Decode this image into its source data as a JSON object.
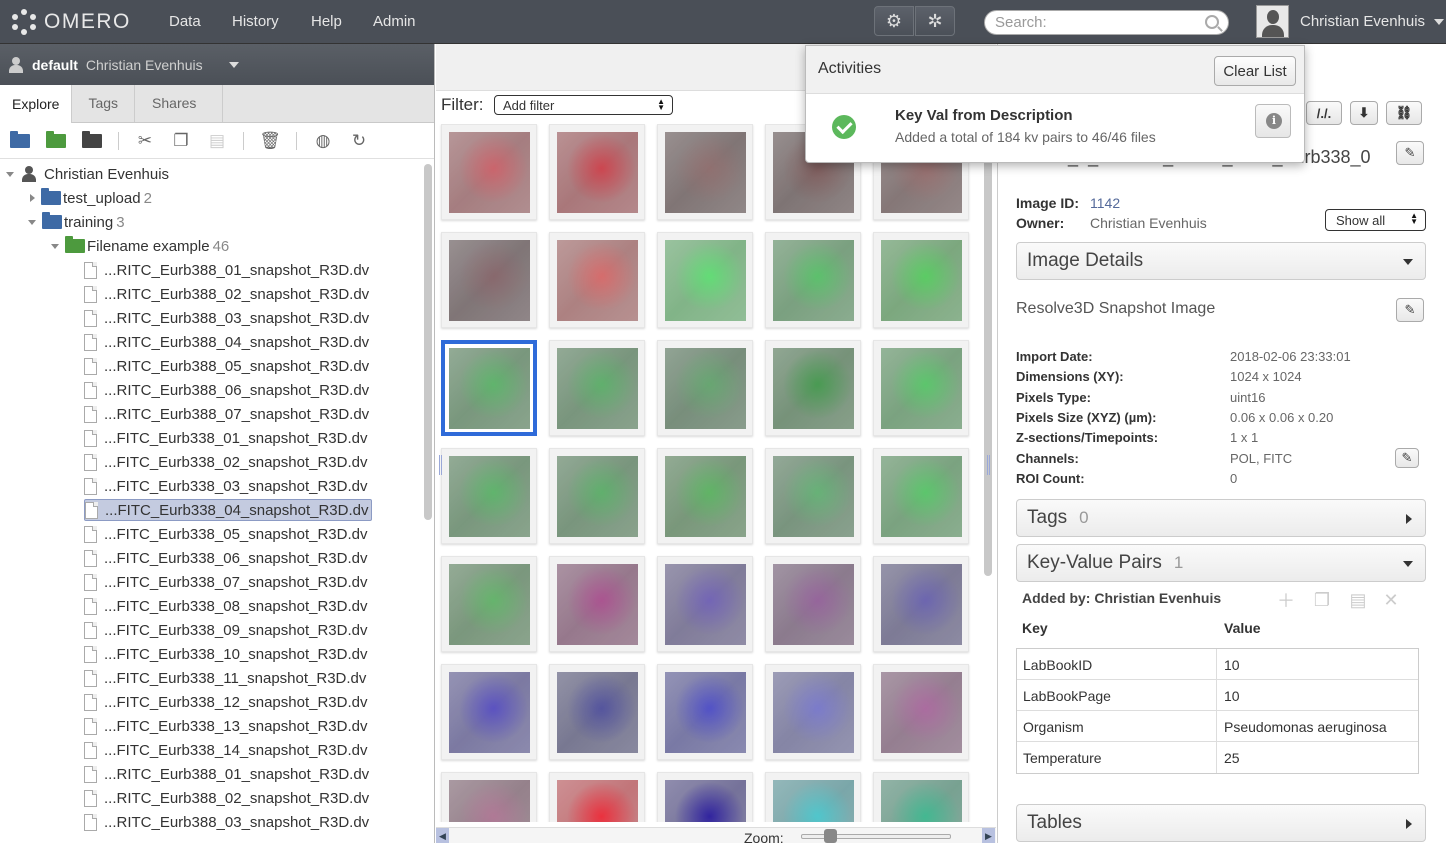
{
  "topbar": {
    "logo_text": "OMERO",
    "nav": [
      "Data",
      "History",
      "Help",
      "Admin"
    ],
    "search_placeholder": "Search:",
    "user_name": "Christian Evenhuis"
  },
  "left": {
    "group": "default",
    "owner": "Christian Evenhuis",
    "tabs": [
      "Explore",
      "Tags",
      "Shares"
    ],
    "active_tab": "Explore",
    "tree": {
      "root": "Christian Evenhuis",
      "projects": [
        {
          "name": "test_upload",
          "count": "2"
        },
        {
          "name": "training",
          "count": "3"
        }
      ],
      "dataset": {
        "name": "Filename example",
        "count": "46"
      },
      "files": [
        "...RITC_Eurb388_01_snapshot_R3D.dv",
        "...RITC_Eurb388_02_snapshot_R3D.dv",
        "...RITC_Eurb388_03_snapshot_R3D.dv",
        "...RITC_Eurb388_04_snapshot_R3D.dv",
        "...RITC_Eurb388_05_snapshot_R3D.dv",
        "...RITC_Eurb388_06_snapshot_R3D.dv",
        "...RITC_Eurb388_07_snapshot_R3D.dv",
        "...FITC_Eurb338_01_snapshot_R3D.dv",
        "...FITC_Eurb338_02_snapshot_R3D.dv",
        "...FITC_Eurb338_03_snapshot_R3D.dv",
        "...FITC_Eurb338_04_snapshot_R3D.dv",
        "...FITC_Eurb338_05_snapshot_R3D.dv",
        "...FITC_Eurb338_06_snapshot_R3D.dv",
        "...FITC_Eurb338_07_snapshot_R3D.dv",
        "...FITC_Eurb338_08_snapshot_R3D.dv",
        "...FITC_Eurb338_09_snapshot_R3D.dv",
        "...FITC_Eurb338_10_snapshot_R3D.dv",
        "...FITC_Eurb338_11_snapshot_R3D.dv",
        "...FITC_Eurb338_12_snapshot_R3D.dv",
        "...FITC_Eurb338_13_snapshot_R3D.dv",
        "...FITC_Eurb338_14_snapshot_R3D.dv",
        "...RITC_Eurb388_01_snapshot_R3D.dv",
        "...RITC_Eurb388_02_snapshot_R3D.dv",
        "...RITC_Eurb388_03_snapshot_R3D.dv"
      ],
      "selected_index": 10
    }
  },
  "center": {
    "filter_label": "Filter:",
    "filter_value": "Add filter",
    "zoom_label": "Zoom:",
    "selected_thumb": 10,
    "thumbs": [
      "rgba(220,60,70,.55)",
      "rgba(200,30,40,.65)",
      "rgba(200,80,80,.2)",
      "rgba(120,40,40,.3)",
      "rgba(200,80,80,.25)",
      "rgba(150,60,70,.25)",
      "rgba(230,70,70,.6)",
      "rgba(60,220,80,.7)",
      "rgba(50,200,70,.55)",
      "rgba(50,210,60,.6)",
      "rgba(50,200,70,.45)",
      "rgba(50,190,70,.45)",
      "rgba(60,200,80,.35)",
      "rgba(30,130,40,.6)",
      "rgba(50,210,70,.55)",
      "rgba(50,200,70,.45)",
      "rgba(50,190,70,.45)",
      "rgba(50,200,60,.45)",
      "rgba(60,210,90,.4)",
      "rgba(50,210,70,.55)",
      "rgba(60,200,70,.45)",
      "rgba(160,40,120,.55)",
      "rgba(80,60,190,.5)",
      "rgba(140,60,150,.45)",
      "rgba(70,60,190,.45)",
      "rgba(50,40,190,.6)",
      "rgba(40,40,140,.55)",
      "rgba(40,40,200,.6)",
      "rgba(90,90,220,.55)",
      "rgba(170,70,150,.5)",
      "rgba(190,90,140,.45)",
      "rgba(230,20,30,.8)",
      "rgba(20,10,120,.8)",
      "rgba(40,190,200,.65)",
      "rgba(30,160,110,.7)"
    ]
  },
  "right": {
    "image_name": "Y0070_1_HSM2M_Tubes_FITC_Eurb338_0",
    "image_id_label": "Image ID:",
    "image_id": "1142",
    "owner_label": "Owner:",
    "owner": "Christian Evenhuis",
    "show_all": "Show all",
    "image_details": "Image Details",
    "description": "Resolve3D Snapshot Image",
    "details": [
      {
        "label": "Import Date:",
        "value": "2018-02-06 23:33:01"
      },
      {
        "label": "Dimensions (XY):",
        "value": "1024 x 1024"
      },
      {
        "label": "Pixels Type:",
        "value": "uint16"
      },
      {
        "label": "Pixels Size (XYZ) (µm):",
        "value": "0.06 x 0.06 x 0.20"
      },
      {
        "label": "Z-sections/Timepoints:",
        "value": "1 x 1"
      },
      {
        "label": "Channels:",
        "value": "POL, FITC"
      },
      {
        "label": "ROI Count:",
        "value": "0"
      }
    ],
    "tags_title": "Tags",
    "tags_count": "0",
    "kv_title": "Key-Value Pairs",
    "kv_count": "1",
    "kv_added_by": "Added by: Christian Evenhuis",
    "kv_key_header": "Key",
    "kv_value_header": "Value",
    "kv_rows": [
      {
        "key": "LabBookID",
        "value": "10"
      },
      {
        "key": "LabBookPage",
        "value": "10"
      },
      {
        "key": "Organism",
        "value": "Pseudomonas aeruginosa"
      },
      {
        "key": "Temperature",
        "value": "25"
      }
    ],
    "tables_title": "Tables"
  },
  "activities": {
    "title": "Activities",
    "clear_label": "Clear List",
    "item_name": "Key Val from Description",
    "item_message": "Added a total of 184 kv pairs to 46/46 files"
  }
}
